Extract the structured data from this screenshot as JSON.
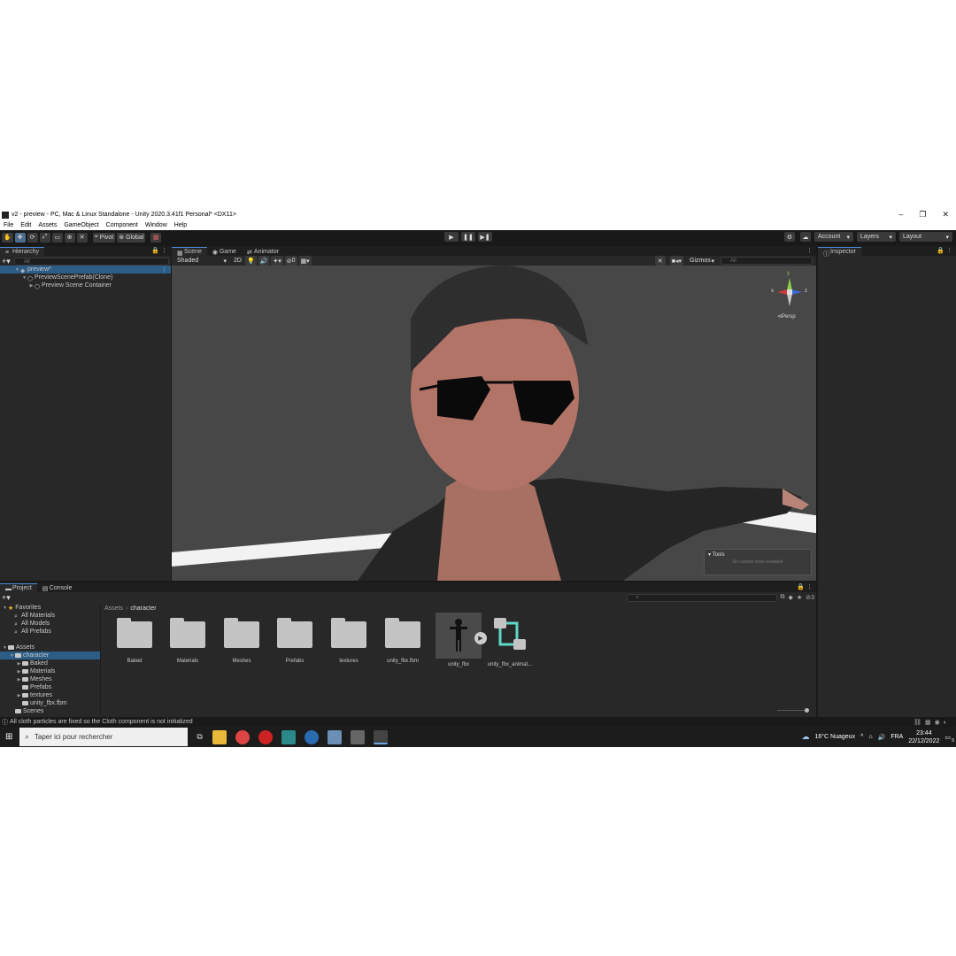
{
  "window": {
    "title": "v2 - preview - PC, Mac & Linux Standalone - Unity 2020.3.41f1 Personal* <DX11>",
    "controls": [
      "–",
      "❐",
      "✕"
    ]
  },
  "menu": [
    "File",
    "Edit",
    "Assets",
    "GameObject",
    "Component",
    "Window",
    "Help"
  ],
  "toolbar": {
    "pivot": "Pivot",
    "global": "Global",
    "account": "Account",
    "layers": "Layers",
    "layout": "Layout"
  },
  "hierarchy": {
    "tab": "Hierarchy",
    "search_placeholder": "All",
    "items": [
      {
        "label": "preview*",
        "depth": 0
      },
      {
        "label": "PreviewScenePrefab(Clone)",
        "depth": 1
      },
      {
        "label": "Preview Scene Container",
        "depth": 2
      }
    ]
  },
  "scene": {
    "tabs": [
      "Scene",
      "Game",
      "Animator"
    ],
    "shading": "Shaded",
    "mode2d": "2D",
    "gizmos": "Gizmos",
    "search_placeholder": "All",
    "fx_count": "0",
    "persp_label": "Persp",
    "axis_x": "x",
    "axis_y": "y",
    "axis_z": "z",
    "overlay_title": "Tools",
    "overlay_text": "No custom tools available"
  },
  "inspector": {
    "tab": "Inspector"
  },
  "project": {
    "tabs": [
      "Project",
      "Console"
    ],
    "breadcrumb_root": "Assets",
    "breadcrumb_current": "character",
    "hidden_count": "3",
    "favorites_label": "Favorites",
    "favorites": [
      "All Materials",
      "All Models",
      "All Prefabs"
    ],
    "assets_label": "Assets",
    "tree": [
      {
        "label": "character",
        "depth": 1
      },
      {
        "label": "Baked",
        "depth": 2
      },
      {
        "label": "Materials",
        "depth": 2
      },
      {
        "label": "Meshes",
        "depth": 2
      },
      {
        "label": "Prefabs",
        "depth": 2
      },
      {
        "label": "textures",
        "depth": 2
      },
      {
        "label": "unity_fbx.fbm",
        "depth": 2
      },
      {
        "label": "Scenes",
        "depth": 1
      }
    ],
    "assets": [
      "Baked",
      "Materials",
      "Meshes",
      "Prefabs",
      "textures",
      "unity_fbx.fbm",
      "unity_fbx",
      "unity_fbx_animat..."
    ]
  },
  "status": {
    "message": "All cloth particles are fixed so the Cloth component is not initialized"
  },
  "taskbar": {
    "search_placeholder": "Taper ici pour rechercher",
    "weather": "16°C  Nuageux",
    "lang": "FRA",
    "time": "23:44",
    "date": "22/12/2022",
    "notif_count": "5"
  },
  "colors": {
    "accent": "#2c5d87",
    "tab_highlight": "#4a8ad4",
    "panel": "#282828",
    "bg": "#191919"
  }
}
